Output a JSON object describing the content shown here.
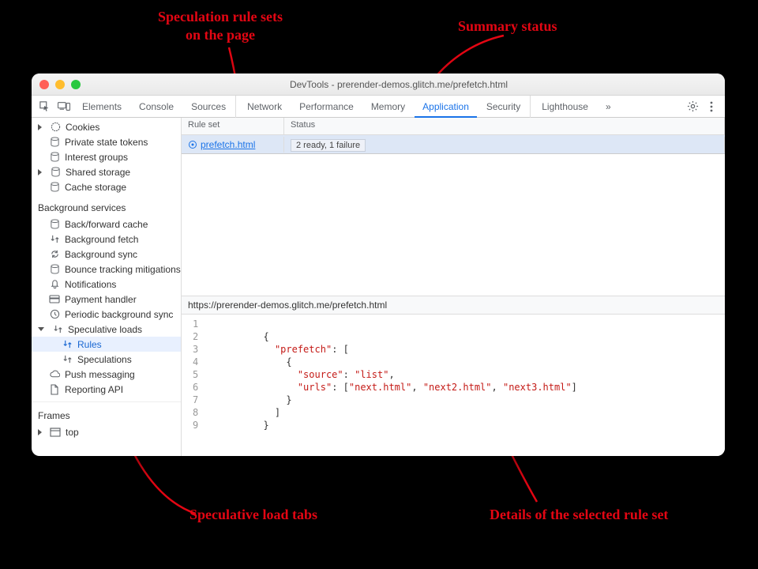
{
  "annotations": {
    "rule_sets": "Speculation rule sets\non the page",
    "summary_status": "Summary status",
    "speculative_tabs": "Speculative load tabs",
    "details": "Details of the selected rule set"
  },
  "titlebar": {
    "title": "DevTools - prerender-demos.glitch.me/prefetch.html"
  },
  "toolbar": {
    "tabs": {
      "elements": "Elements",
      "console": "Console",
      "sources": "Sources",
      "network": "Network",
      "performance": "Performance",
      "memory": "Memory",
      "application": "Application",
      "security": "Security",
      "lighthouse": "Lighthouse"
    },
    "more": "»"
  },
  "sidebar": {
    "storage_items": {
      "cookies": "Cookies",
      "private_state_tokens": "Private state tokens",
      "interest_groups": "Interest groups",
      "shared_storage": "Shared storage",
      "cache_storage": "Cache storage"
    },
    "bg_services_label": "Background services",
    "bg_items": {
      "bf_cache": "Back/forward cache",
      "bg_fetch": "Background fetch",
      "bg_sync": "Background sync",
      "bounce": "Bounce tracking mitigations",
      "notifications": "Notifications",
      "payment": "Payment handler",
      "periodic": "Periodic background sync",
      "speculative": "Speculative loads",
      "rules": "Rules",
      "speculations": "Speculations",
      "push": "Push messaging",
      "reporting": "Reporting API"
    },
    "frames_label": "Frames",
    "frames_top": "top"
  },
  "grid": {
    "col_ruleset": "Rule set",
    "col_status": "Status",
    "row": {
      "ruleset": "prefetch.html",
      "status": "2 ready, 1 failure"
    }
  },
  "urlbar": "https://prerender-demos.glitch.me/prefetch.html",
  "code": {
    "lines": [
      "",
      "{",
      "  \"prefetch\": [",
      "    {",
      "      \"source\": \"list\",",
      "      \"urls\": [\"next.html\", \"next2.html\", \"next3.html\"]",
      "    }",
      "  ]",
      "}"
    ]
  }
}
